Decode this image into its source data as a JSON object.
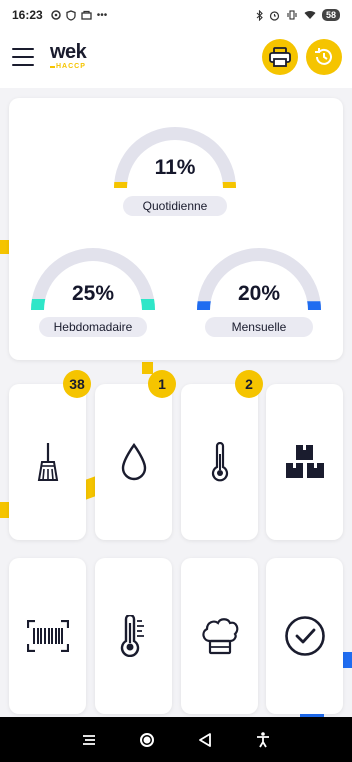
{
  "status_bar": {
    "time": "16:23",
    "battery": "58",
    "icons_left": [
      "settings-icon",
      "vpn-icon",
      "shop-icon",
      "more-icon"
    ],
    "icons_right": [
      "bluetooth-icon",
      "alarm-icon",
      "vibrate-icon",
      "wifi-icon",
      "battery-icon"
    ]
  },
  "app_bar": {
    "logo_main": "wek",
    "logo_sub": "HACCP",
    "actions": [
      "printer-icon",
      "history-icon"
    ]
  },
  "stats": [
    {
      "key": "daily",
      "value": "11%",
      "label": "Quotidienne",
      "progress": 0.11,
      "color": "#f5c400"
    },
    {
      "key": "weekly",
      "value": "25%",
      "label": "Hebdomadaire",
      "progress": 0.25,
      "color": "#2ee6c8"
    },
    {
      "key": "monthly",
      "value": "20%",
      "label": "Mensuelle",
      "progress": 0.2,
      "color": "#1f6cf0"
    }
  ],
  "tiles": [
    {
      "icon": "broom-icon",
      "badge": "38"
    },
    {
      "icon": "water-drop-icon",
      "badge": "1"
    },
    {
      "icon": "thermometer-icon",
      "badge": "2"
    },
    {
      "icon": "boxes-icon",
      "badge": ""
    },
    {
      "icon": "barcode-icon",
      "badge": ""
    },
    {
      "icon": "fridge-thermometer-icon",
      "badge": ""
    },
    {
      "icon": "chef-hat-icon",
      "badge": ""
    },
    {
      "icon": "check-circle-icon",
      "badge": ""
    }
  ],
  "colors": {
    "accent": "#f5c400",
    "navy": "#1a1c2e",
    "gauge_track": "#e2e2ec",
    "weekly": "#2ee6c8",
    "monthly": "#1f6cf0"
  },
  "nav_bar": [
    "menu-nav-icon",
    "home-nav-icon",
    "back-nav-icon",
    "accessibility-nav-icon"
  ]
}
